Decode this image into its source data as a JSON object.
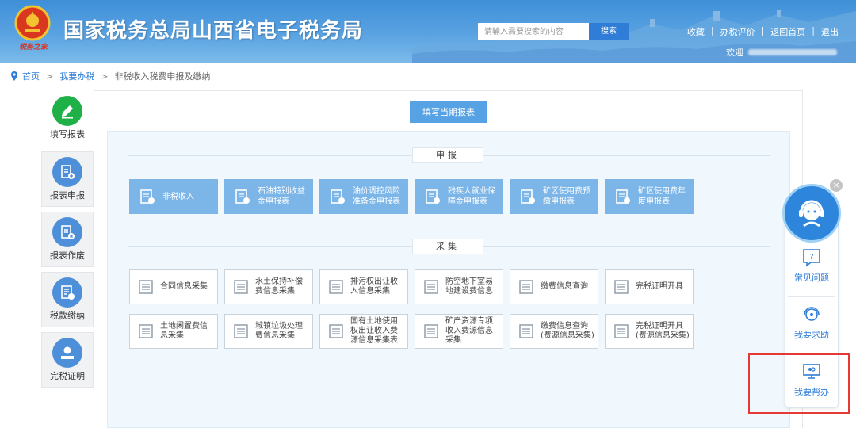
{
  "header": {
    "title": "国家税务总局山西省电子税务局",
    "emblem_text": "税务之家",
    "search_placeholder": "请输入需要搜索的内容",
    "search_button": "搜索",
    "links": [
      "收藏",
      "办税评价",
      "返回首页",
      "退出"
    ],
    "welcome": "欢迎"
  },
  "breadcrumb": {
    "items": [
      "首页",
      "我要办税",
      "非税收入税费申报及缴纳"
    ]
  },
  "leftnav": {
    "items": [
      {
        "label": "填写报表",
        "icon": "pencil-icon",
        "active": true
      },
      {
        "label": "报表申报",
        "icon": "report-upload-icon",
        "active": false
      },
      {
        "label": "报表作废",
        "icon": "report-void-icon",
        "active": false
      },
      {
        "label": "税款缴纳",
        "icon": "tax-payment-icon",
        "active": false
      },
      {
        "label": "完税证明",
        "icon": "certificate-icon",
        "active": false
      }
    ]
  },
  "main": {
    "fill_button": "填写当期报表",
    "declare_section": "申报",
    "collect_section": "采集",
    "declare_items": [
      [
        "非税收入"
      ],
      [
        "石油特别收益",
        "金申报表"
      ],
      [
        "油价调控风险",
        "准备金申报表"
      ],
      [
        "残疾人就业保",
        "障金申报表"
      ],
      [
        "矿区使用费预",
        "缴申报表"
      ],
      [
        "矿区使用费年",
        "度申报表"
      ]
    ],
    "collect_items": [
      [
        "合同信息采集"
      ],
      [
        "水土保持补偿",
        "费信息采集"
      ],
      [
        "排污权出让收",
        "入信息采集"
      ],
      [
        "防空地下室易",
        "地建设费信息"
      ],
      [
        "缴费信息查询"
      ],
      [
        "完税证明开具"
      ],
      [
        "土地闲置费信",
        "息采集"
      ],
      [
        "城镇垃圾处理",
        "费信息采集"
      ],
      [
        "国有土地使用",
        "权出让收入费",
        "源信息采集表"
      ],
      [
        "矿产资源专项",
        "收入费源信息",
        "采集"
      ],
      [
        "缴费信息查询",
        "(费源信息采集)"
      ],
      [
        "完税证明开具",
        "(费源信息采集)"
      ]
    ]
  },
  "help": {
    "close": "×",
    "items": [
      "常见问题",
      "我要求助",
      "我要帮办"
    ]
  },
  "colors": {
    "primary": "#2f7dd6",
    "declare": "#7cb5e8",
    "panel": "#f1f8fd",
    "highlight": "#e53935"
  }
}
